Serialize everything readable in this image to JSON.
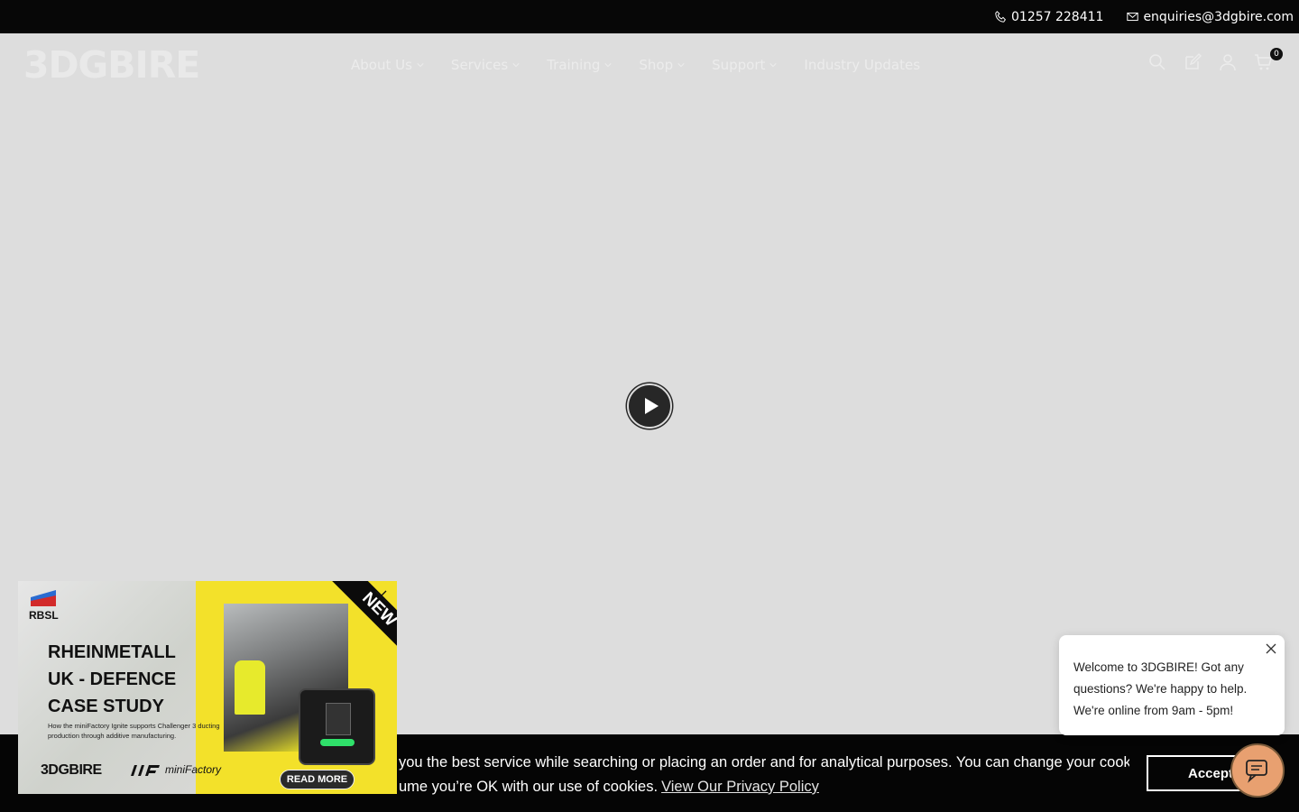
{
  "topbar": {
    "phone": "01257 228411",
    "email": "enquiries@3dgbire.com"
  },
  "header": {
    "logo": "3DGBIRE",
    "nav": [
      {
        "label": "About Us",
        "has_dropdown": true
      },
      {
        "label": "Services",
        "has_dropdown": true
      },
      {
        "label": "Training",
        "has_dropdown": true
      },
      {
        "label": "Shop",
        "has_dropdown": true
      },
      {
        "label": "Support",
        "has_dropdown": true
      },
      {
        "label": "Industry Updates",
        "has_dropdown": false
      }
    ],
    "icons": [
      "search-icon",
      "edit-icon",
      "account-icon",
      "cart-icon"
    ],
    "cart_count": "0"
  },
  "hero": {
    "play_icon": "play-icon"
  },
  "cookie": {
    "line1": "you the best service while searching or placing an order and for analytical purposes. You can change your cookie",
    "line2": "ume you’re OK with our use of cookies.",
    "policy_link": "View Our Privacy Policy",
    "accept": "Accept"
  },
  "chat": {
    "message": "Welcome to 3DGBIRE! Got any questions? We're happy to help. We're online from 9am - 5pm!"
  },
  "promo": {
    "org": "RBSL",
    "title_lines": [
      "RHEINMETALL",
      "UK - DEFENCE",
      "CASE STUDY"
    ],
    "desc": "How the miniFactory Ignite supports Challenger 3 ducting production through additive manufacturing.",
    "brand1": "3DGBIRE",
    "brand2": "miniFactory",
    "read_more": "READ MORE",
    "ribbon": "NEW"
  },
  "colors": {
    "topbar_bg": "#070707",
    "page_bg": "#dddddd",
    "promo_yellow": "#f3e12a",
    "chat_launcher": "#e8a070"
  }
}
